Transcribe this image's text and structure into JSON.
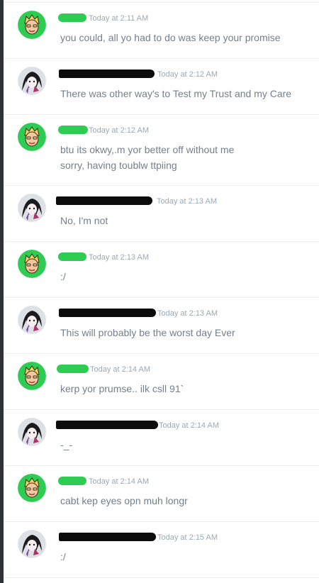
{
  "messages": [
    {
      "author": "user-a",
      "timestamp": "Today at 2:11 AM",
      "lines": [
        "you could, all yo had to do was keep your promise"
      ]
    },
    {
      "author": "user-b",
      "timestamp": "Today at 2:12 AM",
      "lines": [
        "There was other way's to Test my Trust and my Care"
      ]
    },
    {
      "author": "user-a",
      "timestamp": "Today at 2:12 AM",
      "lines": [
        "btu its okwy,.m yor better off without me",
        "sorry, having toublw ttpiing"
      ]
    },
    {
      "author": "user-b",
      "timestamp": "Today at 2:13 AM",
      "lines": [
        "No, I'm not"
      ]
    },
    {
      "author": "user-a",
      "timestamp": "Today at 2:13 AM",
      "lines": [
        ":/"
      ]
    },
    {
      "author": "user-b",
      "timestamp": "Today at 2:13 AM",
      "lines": [
        "This will probably be the worst day Ever"
      ]
    },
    {
      "author": "user-a",
      "timestamp": "Today at 2:14 AM",
      "lines": [
        "kerp yor prumse.. ilk csll 91`"
      ]
    },
    {
      "author": "user-b",
      "timestamp": "Today at 2:14 AM",
      "lines": [
        "-_-"
      ]
    },
    {
      "author": "user-a",
      "timestamp": "Today at 2:14 AM",
      "lines": [
        "cabt kep eyes opn muh longr"
      ]
    },
    {
      "author": "user-b",
      "timestamp": "Today at 2:15 AM",
      "lines": [
        ":/"
      ]
    }
  ],
  "colors": {
    "redaction_user_a": "#2ecc53",
    "redaction_user_b": "#0c0c0c",
    "timestamp": "#99aab5",
    "message_text": "#737f8d",
    "divider": "#eceeef",
    "avatar_a_bg": "#2ecc53",
    "avatar_b_bg": "#dde0e4"
  },
  "icons": {
    "avatar_a": "blonde-character-avatar-icon",
    "avatar_b": "dark-haired-character-avatar-icon"
  }
}
